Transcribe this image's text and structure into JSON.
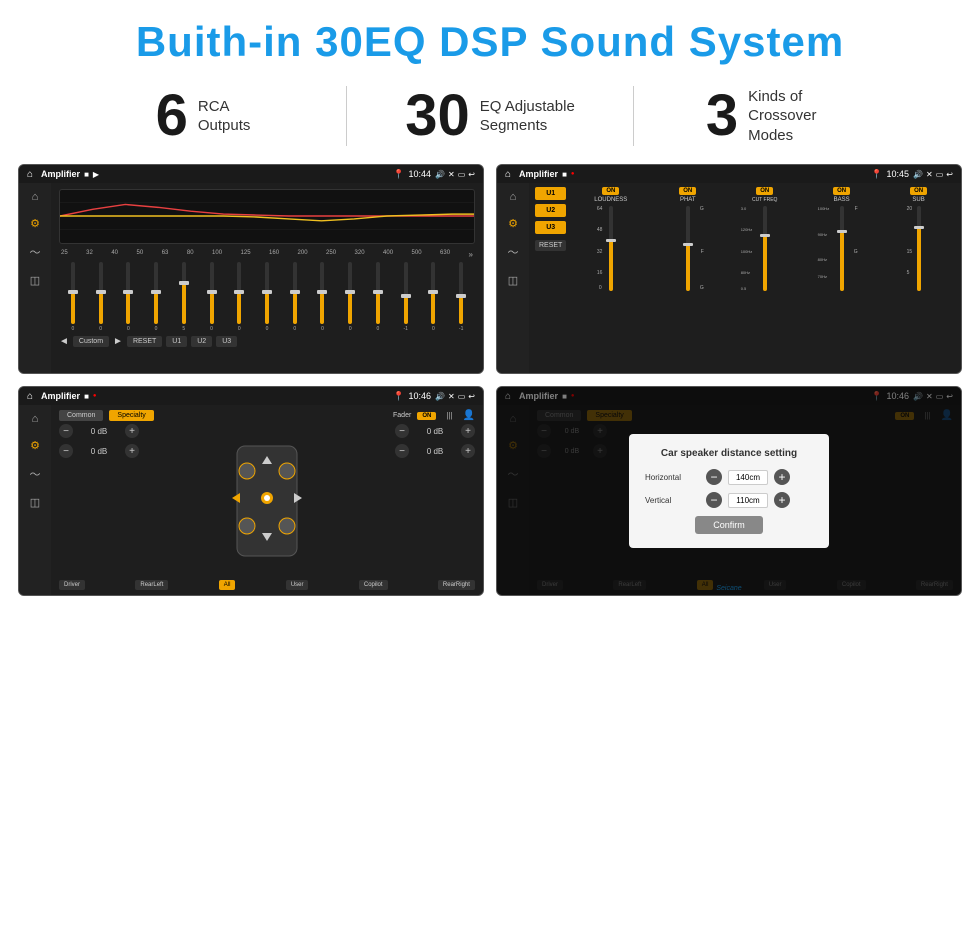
{
  "header": {
    "title": "Buith-in 30EQ DSP Sound System"
  },
  "stats": [
    {
      "number": "6",
      "label": "RCA\nOutputs"
    },
    {
      "number": "30",
      "label": "EQ Adjustable\nSegments"
    },
    {
      "number": "3",
      "label": "Kinds of\nCrossover Modes"
    }
  ],
  "screens": {
    "eq": {
      "status_time": "10:44",
      "title": "Amplifier",
      "freq_labels": [
        "25",
        "32",
        "40",
        "50",
        "63",
        "80",
        "100",
        "125",
        "160",
        "200",
        "250",
        "320",
        "400",
        "500",
        "630"
      ],
      "slider_values": [
        "0",
        "0",
        "0",
        "0",
        "5",
        "0",
        "0",
        "0",
        "0",
        "0",
        "0",
        "0",
        "-1",
        "0",
        "-1"
      ],
      "mode_label": "Custom",
      "buttons": [
        "RESET",
        "U1",
        "U2",
        "U3"
      ]
    },
    "amplifier": {
      "status_time": "10:45",
      "title": "Amplifier",
      "presets": [
        "U1",
        "U2",
        "U3"
      ],
      "channels": [
        "LOUDNESS",
        "PHAT",
        "CUT FREQ",
        "BASS",
        "SUB"
      ],
      "reset_label": "RESET"
    },
    "fader": {
      "status_time": "10:46",
      "title": "Amplifier",
      "tabs": [
        "Common",
        "Specialty"
      ],
      "fader_label": "Fader",
      "on_label": "ON",
      "db_rows": [
        [
          "0 dB",
          "0 dB"
        ],
        [
          "0 dB",
          "0 dB"
        ]
      ],
      "speaker_positions": [
        "Driver",
        "RearLeft",
        "All",
        "User",
        "Copilot",
        "RearRight"
      ]
    },
    "dialog": {
      "status_time": "10:46",
      "title": "Amplifier",
      "dialog_title": "Car speaker distance setting",
      "horizontal_label": "Horizontal",
      "horizontal_value": "140cm",
      "vertical_label": "Vertical",
      "vertical_value": "110cm",
      "confirm_label": "Confirm",
      "db_value": "0 dB",
      "tabs": [
        "Common",
        "Specialty"
      ],
      "speaker_labels": [
        "Driver",
        "RearLeft",
        "All",
        "User",
        "Copilot",
        "RearRight"
      ]
    }
  },
  "watermark": "Seicane"
}
